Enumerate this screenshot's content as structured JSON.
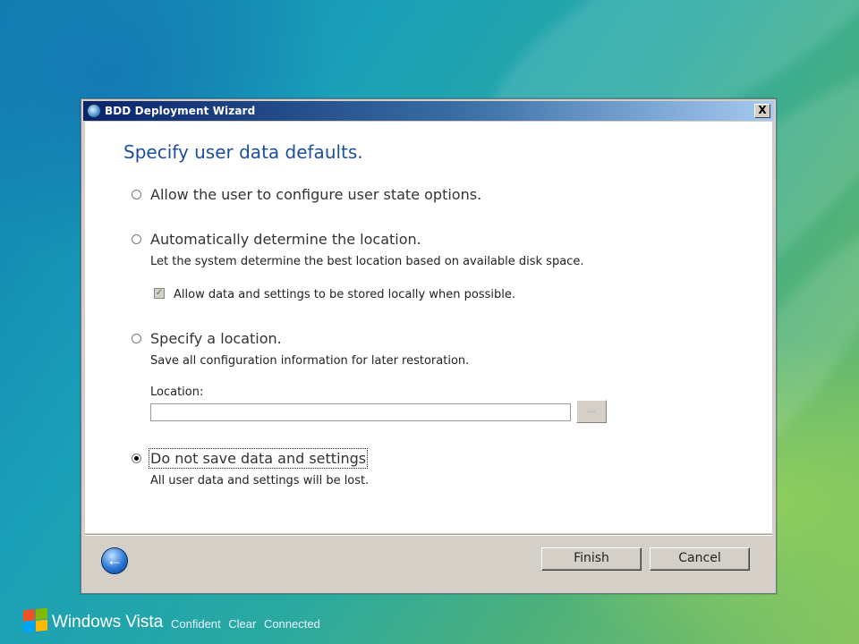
{
  "window": {
    "title": "BDD Deployment Wizard",
    "close_label": "X"
  },
  "page": {
    "heading": "Specify user data defaults."
  },
  "options": [
    {
      "label": "Allow the user to configure user state options.",
      "checked": false
    },
    {
      "label": "Automatically determine the location.",
      "description": "Let the system determine the best location based on available disk space.",
      "checked": false
    },
    {
      "label": "Specify a location.",
      "description": "Save all configuration information for later restoration.",
      "checked": false
    },
    {
      "label": "Do not save data and settings",
      "description": "All user data and settings will be lost.",
      "checked": true
    }
  ],
  "local_checkbox": {
    "label": "Allow data and settings to be stored locally when possible.",
    "checked": true
  },
  "location": {
    "label": "Location:",
    "value": "",
    "browse_label": "..."
  },
  "buttons": {
    "finish": "Finish",
    "cancel": "Cancel"
  },
  "taskbar": {
    "brand": "Windows Vista",
    "tagline": "Confident  Clear  Connected"
  },
  "colors": {
    "heading": "#1b4f9c",
    "titlebar_start": "#0a246a",
    "titlebar_end": "#a6caf0"
  }
}
